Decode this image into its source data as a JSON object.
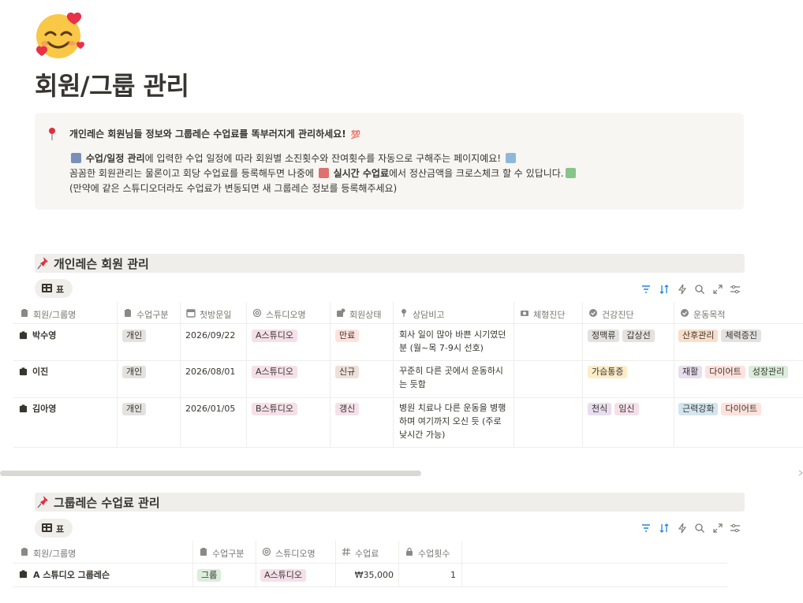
{
  "page": {
    "title": "회원/그룹 관리",
    "icon": "smiling-face-with-hearts-icon"
  },
  "callout": {
    "icon": "round-pushpin-icon",
    "line1": "개인레슨 회원님들 정보와 그룹레슨 수업료를 똑부러지게 관리하세요!",
    "line2a": "수업/일정 관리",
    "line2b": "에 입력한 수업 일정에 따라 회원별 소진횟수와 잔여횟수를 자동으로 구해주는 페이지예요!",
    "line3a": "꼼꼼한 회원관리는 물론이고 회당 수업료를 등록해두면 나중에",
    "line3b": "실시간 수업료",
    "line3c": "에서 정산금액을 크로스체크 할 수 있답니다.",
    "line4": "(만약에 같은 스튜디오더라도 수업료가 변동되면 새 그룹레슨 정보를 등록해주세요)"
  },
  "personal": {
    "section_title": "개인레슨 회원 관리",
    "view_label": "표",
    "columns": [
      "회원/그룹명",
      "수업구분",
      "첫방문일",
      "스튜디오명",
      "회원상태",
      "상담비고",
      "체형진단",
      "건강진단",
      "운동목적"
    ],
    "rows": [
      {
        "name": "박수영",
        "type": "개인",
        "date": "2026/09/22",
        "studio": "A스튜디오",
        "status": "만료",
        "note": [
          "회사 일이 많아 바쁜 시기였던",
          "분 (월~목 7-9시 선호)"
        ],
        "health": [
          "정맥류",
          "갑상선"
        ],
        "goals": [
          "산후관리",
          "체력증진"
        ]
      },
      {
        "name": "이진",
        "type": "개인",
        "date": "2026/08/01",
        "studio": "A스튜디오",
        "status": "신규",
        "note": [
          "꾸준히 다른 곳에서 운동하시",
          "는 듯함"
        ],
        "health": [
          "가슴통증"
        ],
        "goals": [
          "재활",
          "다이어트",
          "성장관리"
        ]
      },
      {
        "name": "김아영",
        "type": "개인",
        "date": "2026/01/05",
        "studio": "B스튜디오",
        "status": "갱신",
        "note": [
          "병원 치료나 다른 운동을 병행",
          "하며 여기까지 오신 듯 (주로",
          "낮시간 가능)"
        ],
        "health": [
          "천식",
          "임신"
        ],
        "goals": [
          "근력강화",
          "다이어트"
        ]
      }
    ]
  },
  "group": {
    "section_title": "그룹레슨 수업료 관리",
    "view_label": "표",
    "columns": [
      "회원/그룹명",
      "수업구분",
      "스튜디오명",
      "수업료",
      "수업횟수"
    ],
    "rows": [
      {
        "name": "A 스튜디오 그룹레슨",
        "type": "그룹",
        "studio": "A스튜디오",
        "fee": "₩35,000",
        "count": "1"
      }
    ]
  },
  "colors": {
    "gray_tag": "#e3e2e0",
    "red_tag": "#ffe2dd",
    "pink_tag": "#f5e0e9",
    "brown_tag": "#eee0da",
    "yellow_tag": "#fdecc8",
    "purple_tag": "#e8deee",
    "green_tag": "#dbeddb",
    "blue_tag": "#d3e5ef",
    "orange_tag": "#fadec9",
    "accent_blue": "#2383e2"
  }
}
